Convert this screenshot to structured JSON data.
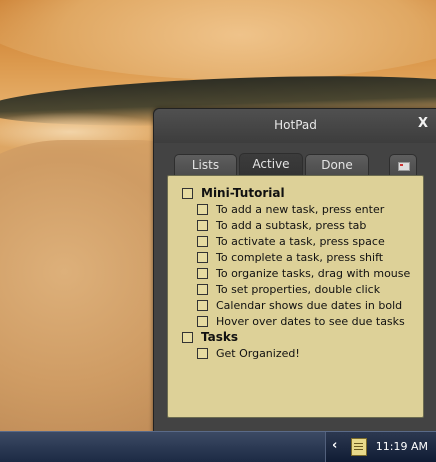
{
  "window": {
    "title": "HotPad",
    "close_label": "X"
  },
  "tabs": [
    {
      "label": "Lists"
    },
    {
      "label": "Active"
    },
    {
      "label": "Done"
    }
  ],
  "tab_icon": "calendar-icon",
  "tasks": [
    {
      "label": "Mini-Tutorial",
      "level": 0,
      "checked": false
    },
    {
      "label": "To add a new task, press enter",
      "level": 1,
      "checked": false
    },
    {
      "label": "To add a subtask, press tab",
      "level": 1,
      "checked": false
    },
    {
      "label": "To activate a task, press space",
      "level": 1,
      "checked": false
    },
    {
      "label": "To complete a task, press shift",
      "level": 1,
      "checked": false
    },
    {
      "label": "To organize tasks, drag with mouse",
      "level": 1,
      "checked": false
    },
    {
      "label": "To set properties, double click",
      "level": 1,
      "checked": false
    },
    {
      "label": "Calendar shows due dates in bold",
      "level": 1,
      "checked": false
    },
    {
      "label": "Hover over dates to see due tasks",
      "level": 1,
      "checked": false
    },
    {
      "label": "Tasks",
      "level": 0,
      "checked": false
    },
    {
      "label": "Get Organized!",
      "level": 1,
      "checked": false
    }
  ],
  "taskbar": {
    "tray_expand_icon": "chevron-left-icon",
    "tray_app_icon": "notepad-icon",
    "clock": "11:19 AM"
  },
  "colors": {
    "window_bg": "#434343",
    "pad_bg": "#ddd198",
    "taskbar_bg": "#1c2a44"
  }
}
